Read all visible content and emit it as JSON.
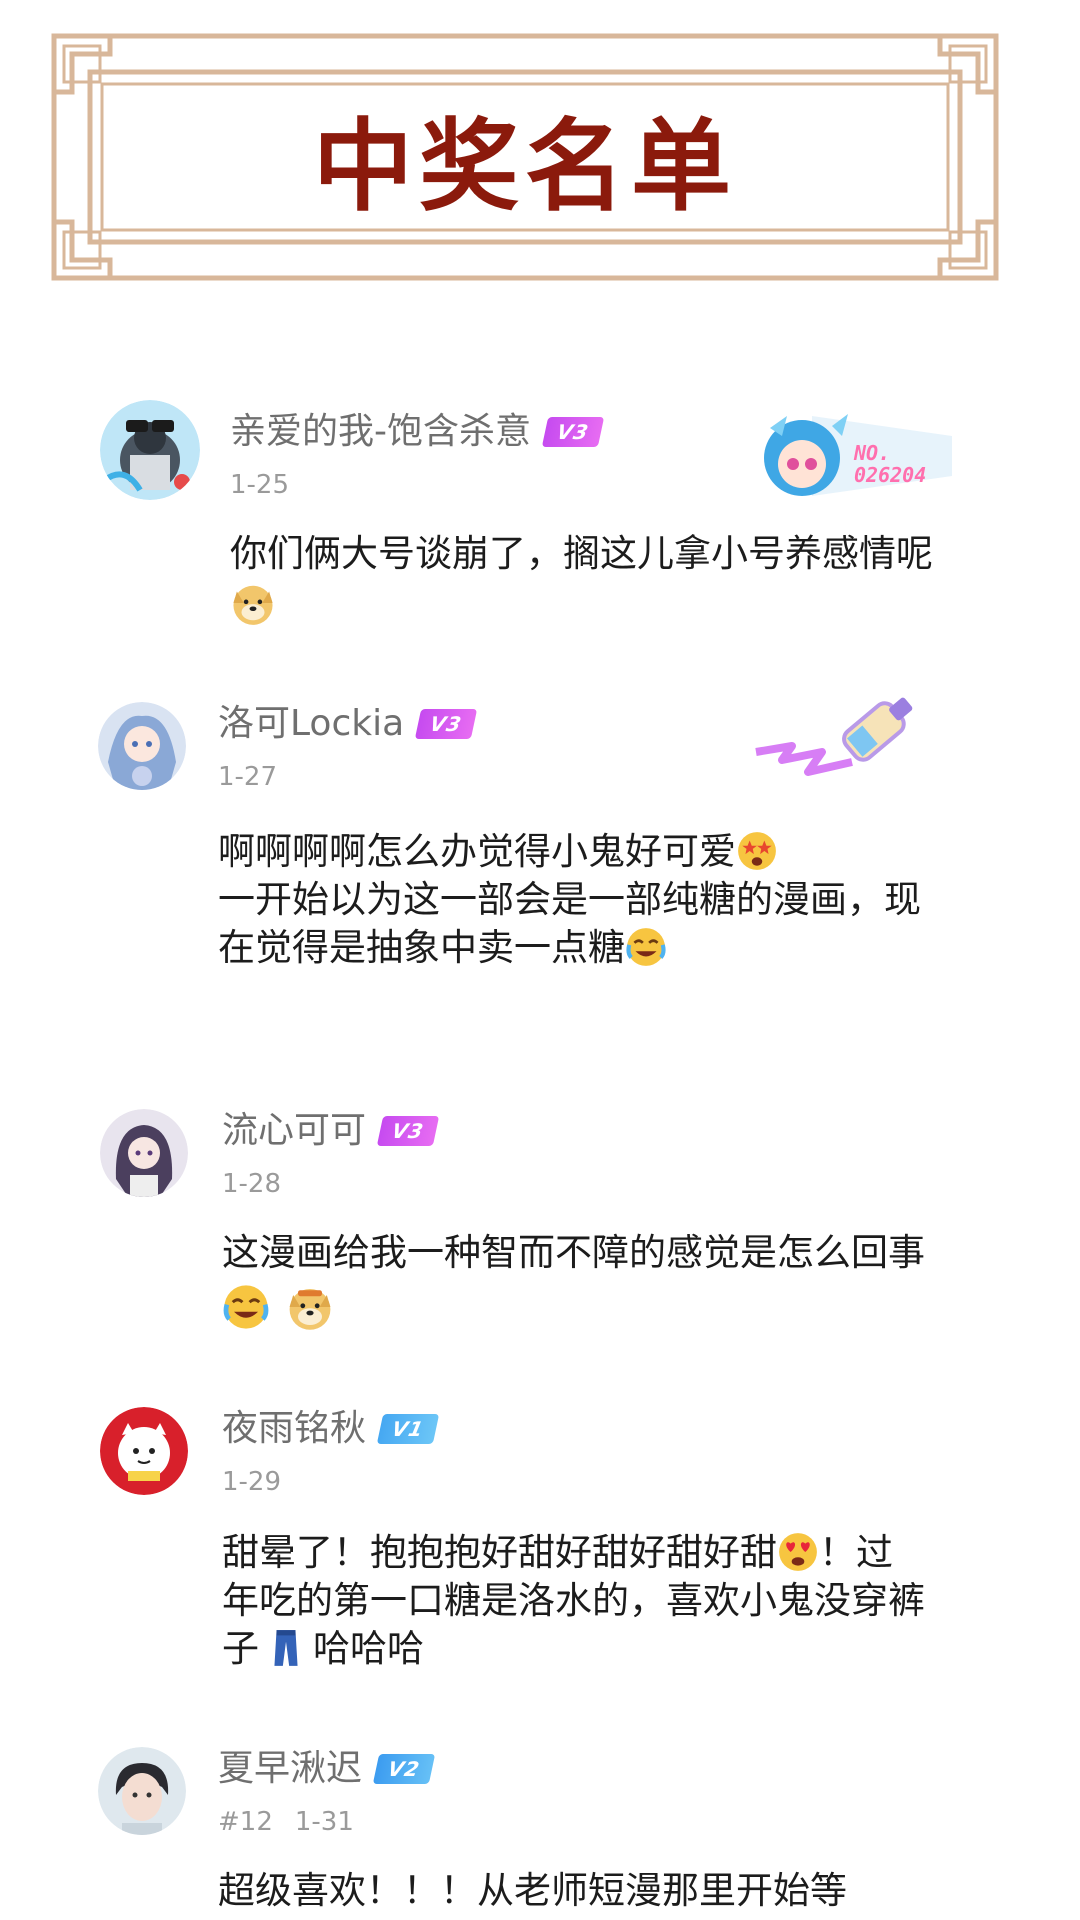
{
  "header": {
    "title": "中奖名单"
  },
  "comments": [
    {
      "username": "亲爱的我-饱含杀意",
      "level": "V3",
      "meta": "1-25",
      "lines": [
        "你们俩大号谈崩了，搁这儿拿小号养感情呢"
      ],
      "emojis": [
        "doge-emoji"
      ],
      "decoration": {
        "number_label": "NO.",
        "number": "026204"
      }
    },
    {
      "username": "洛可Lockia",
      "level": "V3",
      "meta": "1-27",
      "lines": [
        "啊啊啊啊怎么办觉得小鬼好可爱",
        "一开始以为这一部会是一部纯糖的漫画，现",
        "在觉得是抽象中卖一点糖"
      ],
      "emojis": [
        "starry-eyes-emoji",
        "crying-laugh-emoji"
      ]
    },
    {
      "username": "流心可可",
      "level": "V3",
      "meta": "1-28",
      "lines": [
        "这漫画给我一种智而不障的感觉是怎么回事"
      ],
      "emojis": [
        "crying-laugh-emoji",
        "doge-emoji"
      ]
    },
    {
      "username": "夜雨铭秋",
      "level": "V1",
      "meta": "1-29",
      "lines": [
        "甜晕了！抱抱抱好甜好甜好甜好甜",
        "！过",
        "年吃的第一口糖是洛水的，喜欢小鬼没穿裤",
        "子",
        "哈哈哈"
      ],
      "emojis": [
        "heart-eyes-emoji",
        "jeans-emoji"
      ]
    },
    {
      "username": "夏早湫迟",
      "level": "V2",
      "meta_prefix": "#12",
      "meta": "1-31",
      "lines": [
        "超级喜欢！！！从老师短漫那里开始等"
      ]
    }
  ]
}
